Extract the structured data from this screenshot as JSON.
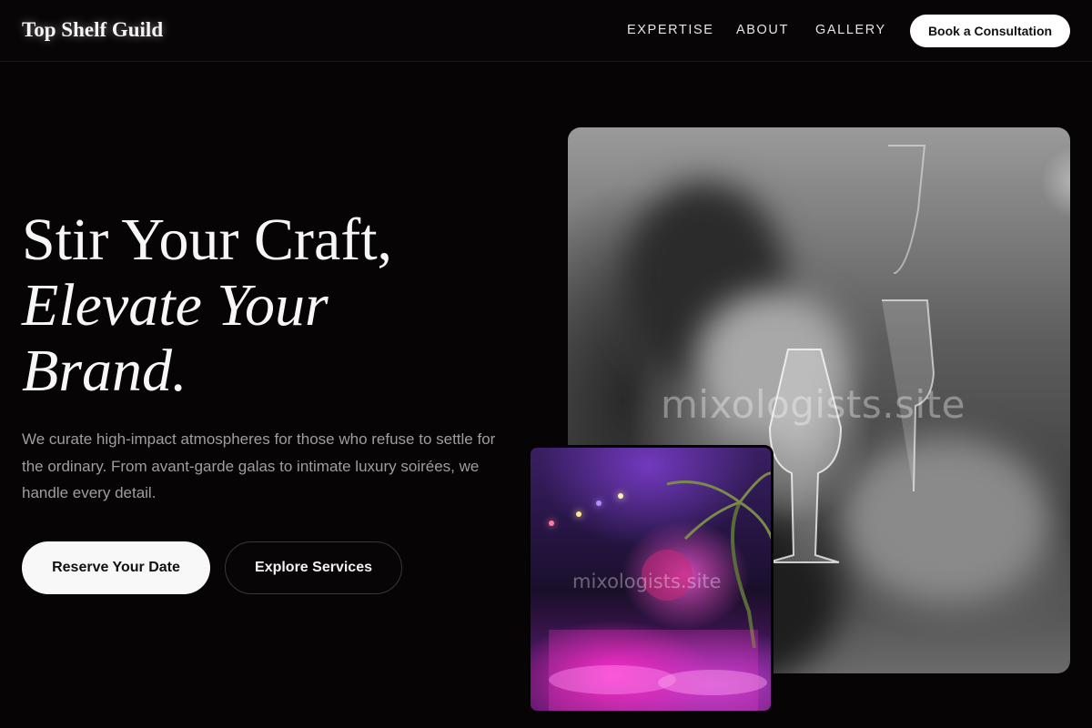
{
  "nav": {
    "logo": "Top Shelf Guild",
    "links": [
      "EXPERTISE",
      "ABOUT",
      "GALLERY"
    ],
    "cta": "Book a Consultation"
  },
  "hero": {
    "headline_line1": "Stir Your Craft,",
    "headline_line2": "Elevate Your",
    "headline_line3": "Brand.",
    "subtitle": "We curate high-impact atmospheres for those who refuse to settle for the ordinary. From avant-garde galas to intimate luxury soirées, we handle every detail.",
    "primary_button": "Reserve Your Date",
    "secondary_button": "Explore Services"
  },
  "images": {
    "main_watermark": "mixologists.site",
    "small_watermark": "mixologists.site"
  },
  "colors": {
    "background": "#060405",
    "text": "#f3f3f3",
    "muted_text": "#a29ca0",
    "button_bg": "#ffffff"
  }
}
